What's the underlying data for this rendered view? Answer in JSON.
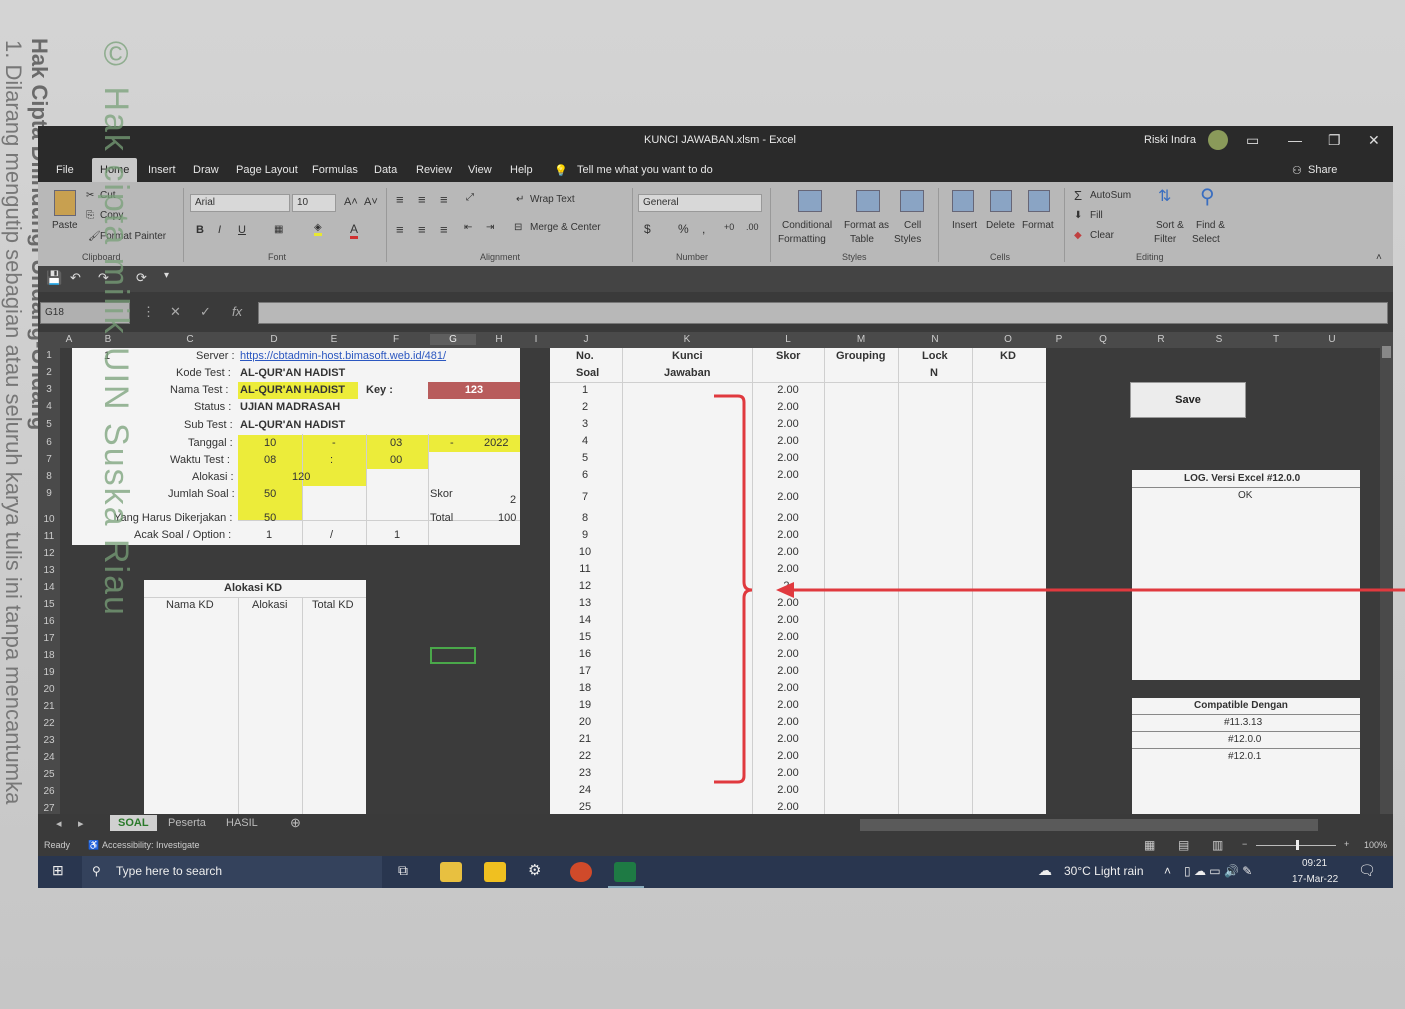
{
  "watermark": {
    "line1": "Hak Cipta Dilindungi Undang-Undang",
    "line2": "1. Dilarang mengutip sebagian atau seluruh karya tulis ini tanpa mencantumka",
    "line3": "© Hak cipta milik UIN Suska Riau"
  },
  "window": {
    "title": "KUNCI JAWABAN.xlsm  -  Excel",
    "user": "Riski Indra"
  },
  "menu": [
    "File",
    "Home",
    "Insert",
    "Draw",
    "Page Layout",
    "Formulas",
    "Data",
    "Review",
    "View",
    "Help"
  ],
  "tell_me": "Tell me what you want to do",
  "share": "Share",
  "ribbon": {
    "cut": "Cut",
    "copy": "Copy",
    "paste": "Paste",
    "format_painter": "Format Painter",
    "clipboard": "Clipboard",
    "font_name": "Arial",
    "font_size": "10",
    "font": "Font",
    "wrap_text": "Wrap Text",
    "merge_center": "Merge & Center",
    "alignment": "Alignment",
    "number_format": "General",
    "number": "Number",
    "conditional_formatting_1": "Conditional",
    "conditional_formatting_2": "Formatting",
    "format_as_table_1": "Format as",
    "format_as_table_2": "Table",
    "cell_styles_1": "Cell",
    "cell_styles_2": "Styles",
    "styles": "Styles",
    "insert": "Insert",
    "delete": "Delete",
    "format": "Format",
    "cells": "Cells",
    "autosum": "AutoSum",
    "fill": "Fill",
    "clear": "Clear",
    "sort_filter_1": "Sort &",
    "sort_filter_2": "Filter",
    "find_select_1": "Find &",
    "find_select_2": "Select",
    "editing": "Editing"
  },
  "name_box": "G18",
  "columns": [
    "A",
    "B",
    "C",
    "D",
    "E",
    "F",
    "G",
    "H",
    "I",
    "J",
    "K",
    "L",
    "M",
    "N",
    "O",
    "P",
    "Q",
    "R",
    "S",
    "T",
    "U"
  ],
  "rows": [
    "1",
    "2",
    "3",
    "4",
    "5",
    "6",
    "7",
    "8",
    "9",
    "10",
    "11",
    "12",
    "13",
    "14",
    "15",
    "16",
    "17",
    "18",
    "19",
    "20",
    "21",
    "22",
    "23",
    "24",
    "25",
    "26",
    "27"
  ],
  "info": {
    "b1": "1",
    "server_label": "Server :",
    "server_value": "https://cbtadmin-host.bimasoft.web.id/481/",
    "kode_label": "Kode Test :",
    "kode_value": "AL-QUR'AN HADIST",
    "nama_label": "Nama Test :",
    "nama_value_1": "AL-QUR'AN",
    "nama_value_2": "HADIST",
    "key_label": "Key :",
    "key_value": "123",
    "status_label": "Status :",
    "status_value": "UJIAN MADRASAH",
    "sub_label": "Sub Test :",
    "sub_value": "AL-QUR'AN HADIST",
    "tanggal_label": "Tanggal :",
    "tanggal_d": "10",
    "tanggal_sep1": "-",
    "tanggal_m": "03",
    "tanggal_sep2": "-",
    "tanggal_y": "2022",
    "waktu_label": "Waktu Test :",
    "waktu_h": "08",
    "waktu_sep": ":",
    "waktu_m": "00",
    "alokasi_label": "Alokasi :",
    "alokasi_value": "120",
    "jumlah_label": "Jumlah Soal :",
    "jumlah_value": "50",
    "skor_label": "Skor",
    "skor_value": "2",
    "harus_label": "Yang Harus Dikerjakan :",
    "harus_value": "50",
    "total_label": "Total",
    "total_value": "100",
    "acak_label": "Acak Soal / Option :",
    "acak_1": "1",
    "acak_sep": "/",
    "acak_2": "1"
  },
  "alokasi_kd": {
    "title": "Alokasi KD",
    "headers": [
      "Nama KD",
      "Alokasi",
      "Total KD"
    ]
  },
  "answer_table": {
    "headers": {
      "no_1": "No.",
      "no_2": "Soal",
      "kunci_1": "Kunci",
      "kunci_2": "Jawaban",
      "skor": "Skor",
      "grouping": "Grouping",
      "lock_1": "Lock",
      "lock_2": "N",
      "kd": "KD"
    },
    "rows": [
      {
        "no": "1",
        "skor": "2.00"
      },
      {
        "no": "2",
        "skor": "2.00"
      },
      {
        "no": "3",
        "skor": "2.00"
      },
      {
        "no": "4",
        "skor": "2.00"
      },
      {
        "no": "5",
        "skor": "2.00"
      },
      {
        "no": "6",
        "skor": "2.00"
      },
      {
        "no": "7",
        "skor": "2.00"
      },
      {
        "no": "8",
        "skor": "2.00"
      },
      {
        "no": "9",
        "skor": "2.00"
      },
      {
        "no": "10",
        "skor": "2.00"
      },
      {
        "no": "11",
        "skor": "2.00"
      },
      {
        "no": "12",
        "skor": "2."
      },
      {
        "no": "13",
        "skor": "2.00"
      },
      {
        "no": "14",
        "skor": "2.00"
      },
      {
        "no": "15",
        "skor": "2.00"
      },
      {
        "no": "16",
        "skor": "2.00"
      },
      {
        "no": "17",
        "skor": "2.00"
      },
      {
        "no": "18",
        "skor": "2.00"
      },
      {
        "no": "19",
        "skor": "2.00"
      },
      {
        "no": "20",
        "skor": "2.00"
      },
      {
        "no": "21",
        "skor": "2.00"
      },
      {
        "no": "22",
        "skor": "2.00"
      },
      {
        "no": "23",
        "skor": "2.00"
      },
      {
        "no": "24",
        "skor": "2.00"
      },
      {
        "no": "25",
        "skor": "2.00"
      }
    ]
  },
  "save_button": "Save",
  "log": {
    "title": "LOG. Versi Excel #12.0.0",
    "status": "OK"
  },
  "compat": {
    "title": "Compatible Dengan",
    "items": [
      "#11.3.13",
      "#12.0.0",
      "#12.0.1"
    ]
  },
  "sheets": [
    "SOAL",
    "Peserta",
    "HASIL"
  ],
  "status": {
    "ready": "Ready",
    "accessibility": "Accessibility: Investigate",
    "zoom": "100%"
  },
  "taskbar": {
    "search": "Type here to search",
    "weather": "30°C  Light rain",
    "time": "09:21",
    "date": "17-Mar-22"
  },
  "colors": {
    "highlight_yellow": "#ecec3a",
    "key_red": "#b85c5c",
    "annotation_red": "#e0393e",
    "link_blue": "#2b57c0"
  }
}
